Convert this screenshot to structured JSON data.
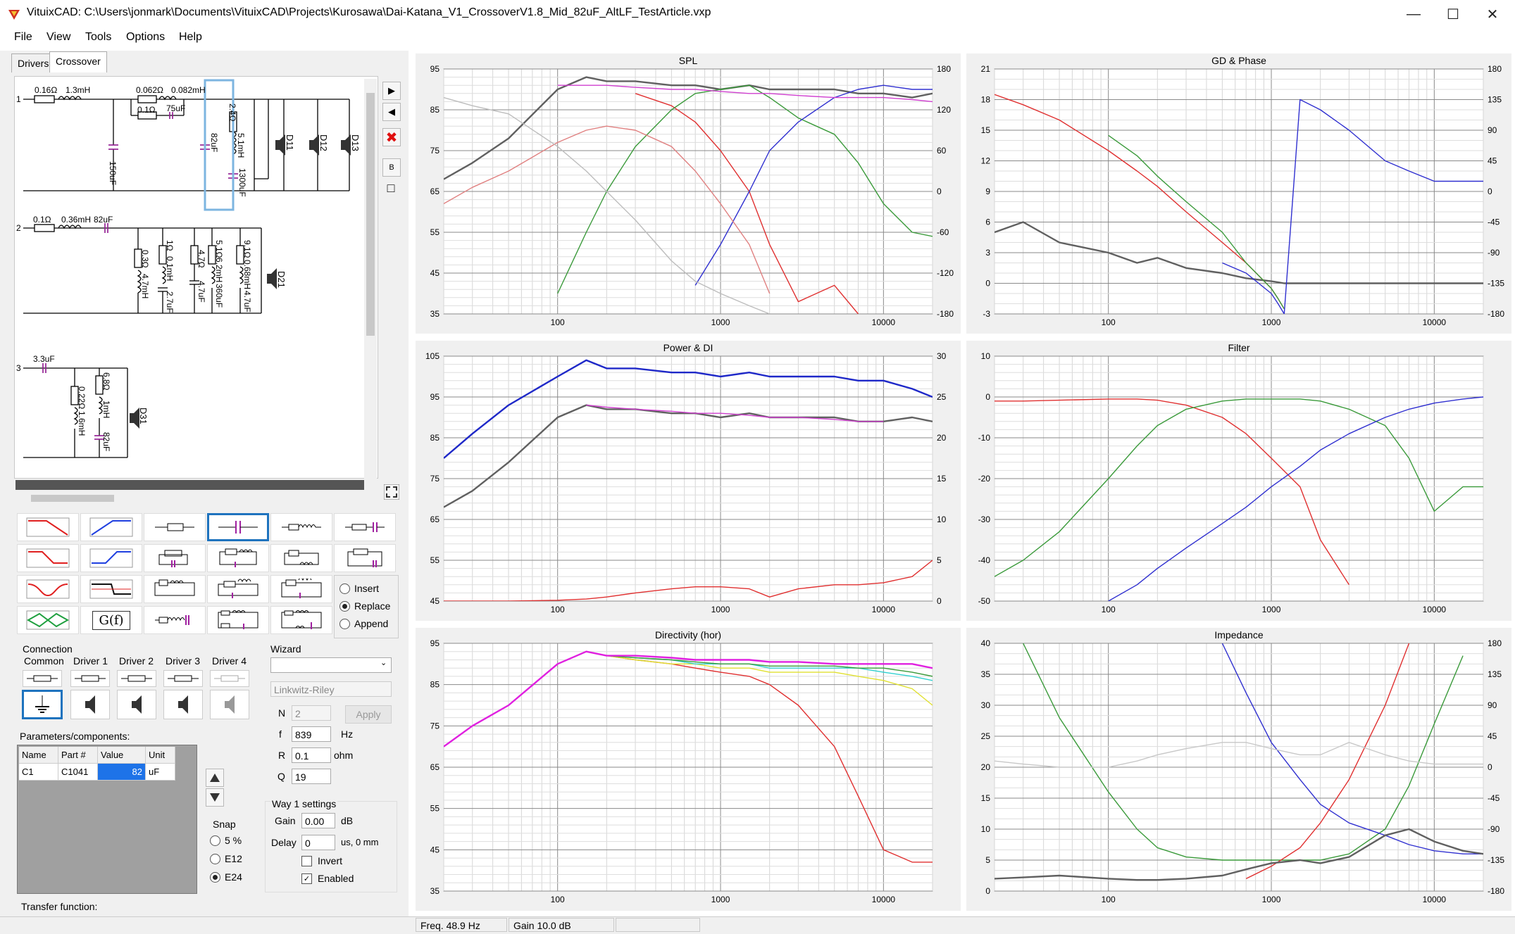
{
  "window": {
    "title": "VituixCAD: C:\\Users\\jonmark\\Documents\\VituixCAD\\Projects\\Kurosawa\\Dai-Katana_V1_CrossoverV1.8_Mid_82uF_AltLF_TestArticle.vxp",
    "minimize": "—",
    "maximize": "☐",
    "close": "✕"
  },
  "menu": [
    "File",
    "View",
    "Tools",
    "Options",
    "Help"
  ],
  "tabs": [
    "Drivers",
    "Crossover"
  ],
  "schematic": {
    "branch1": {
      "num": "1",
      "labels": [
        "0.16Ω",
        "1.3mH",
        "0.062Ω",
        "0.082mH",
        "0.1Ω",
        "75uF",
        "150uF",
        "82uF",
        "2.4Ω",
        "5.1mH",
        "1300uF",
        "D11",
        "D12",
        "D13"
      ]
    },
    "branch2": {
      "num": "2",
      "labels": [
        "0.1Ω",
        "0.36mH",
        "82uF",
        "0.3Ω",
        "4.7mH",
        "1Ω",
        "0.1mH",
        "2.7uF",
        "4.7Ω",
        "4.7uF",
        "5.1Ω",
        "6.2mH",
        "360uF",
        "9.1Ω",
        "0.68mH",
        "4.7uF",
        "D21"
      ]
    },
    "branch3": {
      "num": "3",
      "labels": [
        "3.3uF",
        "0.22Ω",
        "1.6mH",
        "6.8Ω",
        "1mH",
        "82uF",
        "D31"
      ]
    }
  },
  "side_buttons": [
    "▶",
    "◀",
    "✖",
    "B",
    "□"
  ],
  "insert_mode": {
    "options": [
      "Insert",
      "Replace",
      "Append"
    ],
    "selected": "Replace"
  },
  "tf_label": "G(f)",
  "connection": {
    "title": "Connection",
    "columns": [
      "Common",
      "Driver 1",
      "Driver 2",
      "Driver 3",
      "Driver 4"
    ]
  },
  "wizard": {
    "title": "Wizard",
    "type_value": "",
    "filter_value": "Linkwitz-Riley",
    "order_label": "N",
    "order_value": "2",
    "apply": "Apply",
    "f_label": "f",
    "f_value": "839",
    "f_unit": "Hz",
    "r_label": "R",
    "r_value": "0.1",
    "r_unit": "ohm",
    "q_label": "Q",
    "q_value": "19"
  },
  "params": {
    "title": "Parameters/components:",
    "headers": [
      "Name",
      "Part #",
      "Value",
      "Unit"
    ],
    "row": [
      "C1",
      "C1041",
      "82",
      "uF"
    ]
  },
  "snap": {
    "title": "Snap",
    "options": [
      "5 %",
      "E12",
      "E24"
    ],
    "selected": "E24"
  },
  "way": {
    "title": "Way 1 settings",
    "gain_label": "Gain",
    "gain_value": "0.00",
    "gain_unit": "dB",
    "delay_label": "Delay",
    "delay_value": "0",
    "delay_unit": "us, 0 mm",
    "invert_label": "Invert",
    "invert_checked": false,
    "enabled_label": "Enabled",
    "enabled_checked": true
  },
  "transfer_label": "Transfer function:",
  "status": {
    "freq": "Freq. 48.9 Hz",
    "gain": "Gain 10.0 dB"
  },
  "chart_data": [
    {
      "type": "line",
      "title": "SPL",
      "x_ticks": [
        "100",
        "1000",
        "10000"
      ],
      "ylim": [
        35,
        95
      ],
      "y_ticks": [
        "95",
        "85",
        "75",
        "65",
        "55",
        "45",
        "35"
      ],
      "y2_ticks": [
        "180",
        "120",
        "60",
        "0",
        "-60",
        "-120",
        "-180"
      ],
      "x": [
        20,
        30,
        50,
        100,
        150,
        200,
        300,
        500,
        700,
        1000,
        1500,
        2000,
        3000,
        5000,
        7000,
        10000,
        15000,
        20000
      ],
      "series": [
        {
          "color": "#606060",
          "values": [
            68,
            72,
            78,
            90,
            93,
            92,
            92,
            91,
            91,
            90,
            91,
            90,
            90,
            90,
            89,
            89,
            88,
            89
          ]
        },
        {
          "color": "#e03030",
          "values": [
            null,
            null,
            null,
            null,
            null,
            null,
            89,
            86,
            82,
            75,
            65,
            52,
            38,
            42,
            35,
            null,
            null,
            null
          ]
        },
        {
          "color": "#3a9a3a",
          "values": [
            null,
            null,
            null,
            40,
            55,
            65,
            76,
            85,
            89,
            90,
            91,
            88,
            83,
            79,
            72,
            62,
            55,
            54
          ]
        },
        {
          "color": "#3030d0",
          "values": [
            null,
            null,
            null,
            null,
            null,
            null,
            null,
            null,
            42,
            52,
            65,
            75,
            82,
            88,
            90,
            91,
            90,
            90
          ]
        },
        {
          "color": "#e08080",
          "values": [
            62,
            66,
            70,
            77,
            80,
            81,
            80,
            76,
            70,
            62,
            52,
            40,
            null,
            null,
            null,
            null,
            null,
            null
          ]
        },
        {
          "color": "#bdbdbd",
          "values": [
            88,
            86,
            84,
            76,
            70,
            65,
            58,
            48,
            43,
            40,
            37,
            35,
            null,
            null,
            null,
            null,
            null,
            null
          ]
        },
        {
          "color": "#d040d0",
          "values": [
            null,
            null,
            null,
            91,
            91,
            91,
            90.5,
            90,
            90,
            89.5,
            89,
            89,
            88.5,
            88,
            88,
            88,
            87.5,
            87
          ]
        }
      ]
    },
    {
      "type": "line",
      "title": "GD & Phase",
      "x_ticks": [
        "100",
        "1000",
        "10000"
      ],
      "ylim": [
        -3,
        21
      ],
      "y_ticks": [
        "21",
        "18",
        "15",
        "12",
        "9",
        "6",
        "3",
        "0",
        "-3"
      ],
      "y2_ticks": [
        "180",
        "135",
        "90",
        "45",
        "0",
        "-45",
        "-90",
        "-135",
        "-180"
      ],
      "x": [
        20,
        30,
        50,
        100,
        150,
        200,
        300,
        500,
        700,
        1000,
        1100,
        1200,
        1500,
        2000,
        3000,
        5000,
        7000,
        10000,
        15000,
        20000
      ],
      "series": [
        {
          "color": "#606060",
          "values": [
            5,
            6,
            4,
            3,
            2,
            2.5,
            1.5,
            1,
            0.5,
            0.2,
            0.1,
            0,
            0,
            0,
            0,
            0,
            0,
            0,
            0,
            0
          ]
        },
        {
          "color": "#e03030",
          "values": [
            18.5,
            17.5,
            16,
            13,
            11,
            9.5,
            7,
            4,
            2,
            -0.5,
            -1.5,
            -2.5,
            null,
            null,
            null,
            null,
            null,
            null,
            null,
            null
          ]
        },
        {
          "color": "#3a9a3a",
          "values": [
            null,
            null,
            null,
            14.5,
            12.5,
            10.5,
            8,
            5,
            2,
            -0.5,
            -1.5,
            -2.5,
            null,
            null,
            null,
            null,
            null,
            null,
            null,
            null
          ]
        },
        {
          "color": "#3030d0",
          "values": [
            null,
            null,
            null,
            null,
            null,
            null,
            null,
            2,
            1,
            -1,
            -2,
            -3,
            18,
            17,
            15,
            12,
            11,
            10,
            10,
            10
          ]
        }
      ]
    },
    {
      "type": "line",
      "title": "Power & DI",
      "x_ticks": [
        "100",
        "1000",
        "10000"
      ],
      "ylim": [
        45,
        105
      ],
      "y_ticks": [
        "105",
        "95",
        "85",
        "75",
        "65",
        "55",
        "45"
      ],
      "y2_ticks": [
        "30",
        "25",
        "20",
        "15",
        "10",
        "5",
        "0"
      ],
      "x": [
        20,
        30,
        50,
        100,
        150,
        200,
        300,
        500,
        700,
        1000,
        1500,
        2000,
        3000,
        5000,
        7000,
        10000,
        15000,
        20000
      ],
      "series": [
        {
          "color": "#1e28c8",
          "values": [
            80,
            86,
            93,
            100,
            104,
            102,
            102,
            101,
            101,
            100,
            101,
            100,
            100,
            100,
            99,
            99,
            97,
            95
          ]
        },
        {
          "color": "#606060",
          "values": [
            68,
            72,
            79,
            90,
            93,
            92,
            92,
            91,
            91,
            90,
            91,
            90,
            90,
            90,
            89,
            89,
            90,
            89
          ]
        },
        {
          "color": "#d040d0",
          "values": [
            null,
            null,
            null,
            null,
            93,
            92.5,
            92,
            91.5,
            91,
            91,
            90.5,
            90,
            90,
            89.5,
            89,
            89,
            null,
            null
          ]
        },
        {
          "color": "#e03030",
          "values": [
            45,
            45,
            45,
            45.2,
            45.5,
            46,
            47,
            48,
            48.5,
            48.5,
            48,
            46,
            48,
            49,
            49,
            49.5,
            51,
            55
          ]
        }
      ]
    },
    {
      "type": "line",
      "title": "Filter",
      "x_ticks": [
        "100",
        "1000",
        "10000"
      ],
      "ylim": [
        -50,
        10
      ],
      "y_ticks": [
        "10",
        "0",
        "-10",
        "-20",
        "-30",
        "-40",
        "-50"
      ],
      "x": [
        20,
        30,
        50,
        100,
        150,
        200,
        300,
        500,
        700,
        1000,
        1500,
        2000,
        3000,
        5000,
        7000,
        10000,
        15000,
        20000
      ],
      "series": [
        {
          "color": "#e03030",
          "values": [
            -1,
            -1,
            -0.8,
            -0.5,
            -0.5,
            -0.8,
            -2,
            -5,
            -9,
            -15,
            -22,
            -35,
            -46,
            null,
            null,
            null,
            null,
            null
          ]
        },
        {
          "color": "#3a9a3a",
          "values": [
            -44,
            -40,
            -33,
            -20,
            -12,
            -7,
            -3,
            -1,
            -0.5,
            -0.5,
            -0.5,
            -1,
            -3,
            -7,
            -15,
            -28,
            -22,
            -22
          ]
        },
        {
          "color": "#3030d0",
          "values": [
            null,
            null,
            null,
            -50,
            -46,
            -42,
            -37,
            -31,
            -27,
            -22,
            -17,
            -13,
            -9,
            -5,
            -3,
            -1.5,
            -0.5,
            0
          ]
        }
      ]
    },
    {
      "type": "line",
      "title": "Directivity (hor)",
      "x_ticks": [
        "100",
        "1000",
        "10000"
      ],
      "ylim": [
        35,
        95
      ],
      "y_ticks": [
        "95",
        "85",
        "75",
        "65",
        "55",
        "45",
        "35"
      ],
      "x": [
        20,
        30,
        50,
        100,
        150,
        200,
        300,
        500,
        700,
        1000,
        1500,
        2000,
        3000,
        5000,
        7000,
        10000,
        15000,
        20000
      ],
      "series": [
        {
          "color": "#e03030",
          "values": [
            70,
            75,
            80,
            90,
            93,
            92,
            91,
            90,
            89,
            88,
            87,
            85,
            80,
            70,
            58,
            45,
            42,
            42
          ]
        },
        {
          "color": "#e0e030",
          "values": [
            70,
            75,
            80,
            90,
            93,
            92,
            91,
            90,
            90,
            89,
            89,
            88,
            88,
            88,
            87,
            86,
            84,
            80
          ]
        },
        {
          "color": "#30d0d0",
          "values": [
            70,
            75,
            80,
            90,
            93,
            92,
            91.5,
            91,
            90,
            90,
            90,
            89,
            89,
            89,
            89,
            88,
            87,
            86
          ]
        },
        {
          "color": "#3a9a3a",
          "values": [
            70,
            75,
            80,
            90,
            93,
            92,
            91.5,
            91,
            90.5,
            90,
            90,
            89.5,
            89.5,
            89.5,
            89,
            89,
            88,
            87
          ]
        },
        {
          "color": "#e020e0",
          "values": [
            70,
            75,
            80,
            90,
            93,
            92,
            92,
            91.5,
            91,
            91,
            91,
            90.5,
            90.5,
            90,
            90,
            90,
            90,
            89
          ]
        }
      ]
    },
    {
      "type": "line",
      "title": "Impedance",
      "x_ticks": [
        "100",
        "1000",
        "10000"
      ],
      "ylim": [
        0,
        40
      ],
      "y_ticks": [
        "40",
        "35",
        "30",
        "25",
        "20",
        "15",
        "10",
        "5",
        "0"
      ],
      "y2_ticks": [
        "180",
        "135",
        "90",
        "45",
        "0",
        "-45",
        "-90",
        "-135",
        "-180"
      ],
      "x": [
        20,
        30,
        50,
        100,
        150,
        200,
        300,
        500,
        700,
        1000,
        1500,
        2000,
        3000,
        5000,
        7000,
        10000,
        15000,
        20000
      ],
      "series": [
        {
          "color": "#3a9a3a",
          "values": [
            null,
            40,
            28,
            16,
            10,
            7,
            5.5,
            5,
            5,
            5,
            5,
            5,
            6,
            10,
            17,
            27,
            38,
            null
          ]
        },
        {
          "color": "#3030d0",
          "values": [
            null,
            null,
            null,
            null,
            null,
            null,
            null,
            40,
            32,
            24,
            18,
            14,
            11,
            9,
            7.5,
            6.5,
            6,
            6
          ]
        },
        {
          "color": "#e03030",
          "values": [
            null,
            null,
            null,
            null,
            null,
            null,
            null,
            null,
            2,
            4,
            7,
            11,
            18,
            30,
            40,
            null,
            null,
            null
          ]
        },
        {
          "color": "#606060",
          "values": [
            2,
            2.2,
            2.5,
            2,
            1.8,
            1.8,
            2,
            2.5,
            3.5,
            4.5,
            5,
            4.5,
            5.5,
            9,
            10,
            8,
            6.5,
            6
          ]
        },
        {
          "color": "#c8c8c8",
          "values": [
            21,
            20.5,
            20,
            20,
            21,
            22,
            23,
            24,
            24,
            23,
            22,
            22,
            24,
            22,
            21,
            20.5,
            20.5,
            20.5
          ]
        }
      ]
    }
  ]
}
